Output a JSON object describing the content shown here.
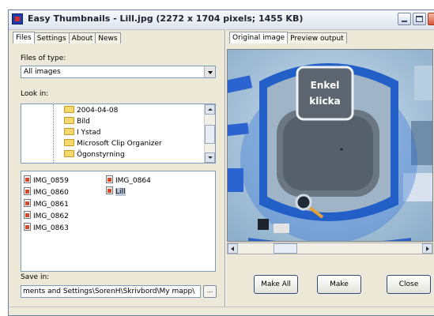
{
  "window": {
    "title": "Easy Thumbnails - Lill.jpg  (2272 x 1704 pixels;  1455 KB)"
  },
  "left_tabs": [
    {
      "label": "Files",
      "active": true
    },
    {
      "label": "Settings",
      "active": false
    },
    {
      "label": "About",
      "active": false
    },
    {
      "label": "News",
      "active": false
    }
  ],
  "right_tabs": [
    {
      "label": "Original image",
      "active": true
    },
    {
      "label": "Preview output",
      "active": false
    }
  ],
  "files_of_type": {
    "label": "Files of type:",
    "value": "All images"
  },
  "look_in": {
    "label": "Look in:",
    "folders": [
      "2004-04-08",
      "Bild",
      "I Ystad",
      "Microsoft Clip Organizer",
      "Ögonstyrning"
    ]
  },
  "file_list": {
    "col1": [
      "IMG_0859",
      "IMG_0860",
      "IMG_0861",
      "IMG_0862",
      "IMG_0863"
    ],
    "col2": [
      "IMG_0864",
      "Lill"
    ],
    "selected": "Lill"
  },
  "save_in": {
    "label": "Save in:",
    "value": "ments and Settings\\SorenH\\Skrivbord\\My mapp\\",
    "browse_label": "..."
  },
  "preview_image": {
    "sign_line1": "Enkel",
    "sign_line2": "klicka"
  },
  "buttons": {
    "make_all": "Make All",
    "make": "Make",
    "close": "Close"
  }
}
